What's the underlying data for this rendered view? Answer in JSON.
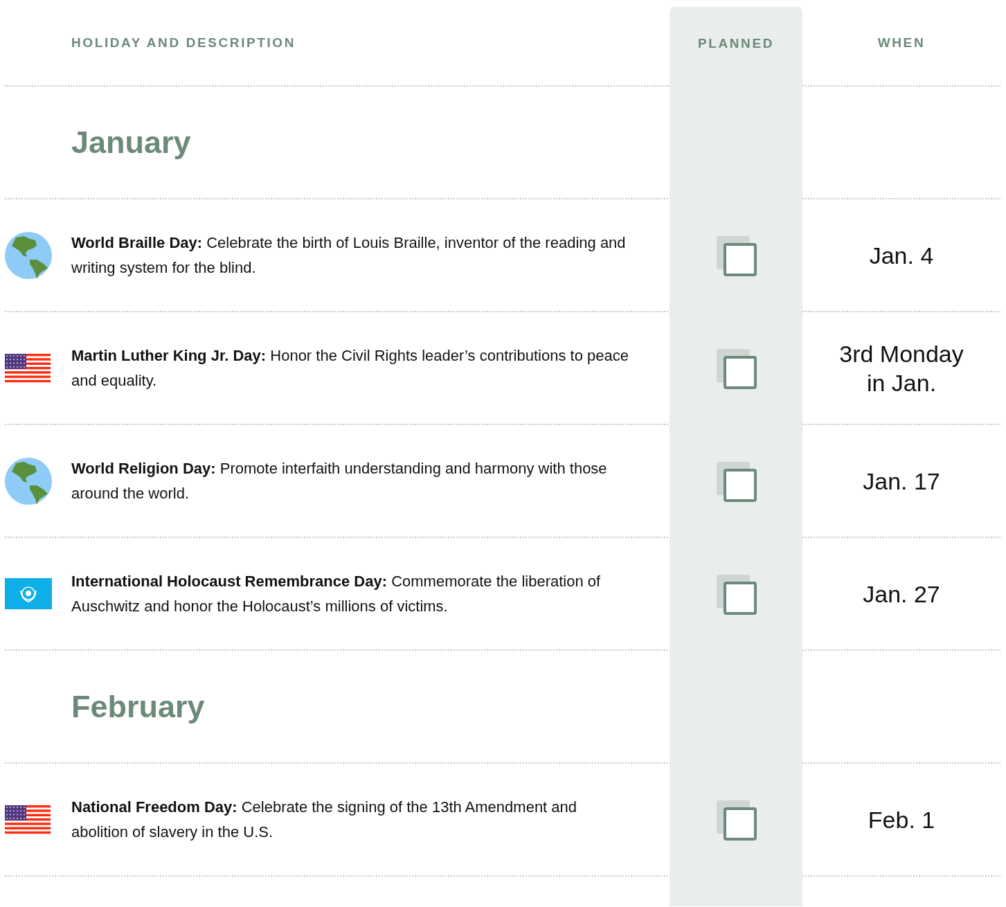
{
  "columns": [
    "HOLIDAY AND DESCRIPTION",
    "PLANNED",
    "WHEN"
  ],
  "rows": [
    {
      "kind": "month",
      "title": "January"
    },
    {
      "kind": "holiday",
      "icon": {
        "kind": "globe"
      },
      "name": "World Braille Day:",
      "description": "Celebrate the birth of Louis Braille, inventor of the reading and writing system for the blind.",
      "checked": false,
      "when": "Jan. 4"
    },
    {
      "kind": "holiday",
      "icon": {
        "kind": "us-flag"
      },
      "name": "Martin Luther King Jr. Day:",
      "description": "Honor the Civil Rights leader’s contributions to peace and equality.",
      "checked": false,
      "when": "3rd Monday in Jan."
    },
    {
      "kind": "holiday",
      "icon": {
        "kind": "globe"
      },
      "name": "World Religion Day:",
      "description": "Promote interfaith understanding and harmony with those around the world.",
      "checked": false,
      "when": "Jan. 17"
    },
    {
      "kind": "holiday",
      "icon": {
        "kind": "un-flag"
      },
      "name": "International Holocaust Remembrance Day:",
      "description": "Commemorate the liberation of Auschwitz and honor the Holocaust’s millions of victims.",
      "checked": false,
      "when": "Jan. 27"
    },
    {
      "kind": "month",
      "title": "February"
    },
    {
      "kind": "holiday",
      "icon": {
        "kind": "us-flag"
      },
      "name": "National Freedom Day:",
      "description": "Celebrate the signing of the 13th Amendment and abolition of slavery in the U.S.",
      "checked": false,
      "when": "Feb. 1"
    }
  ]
}
